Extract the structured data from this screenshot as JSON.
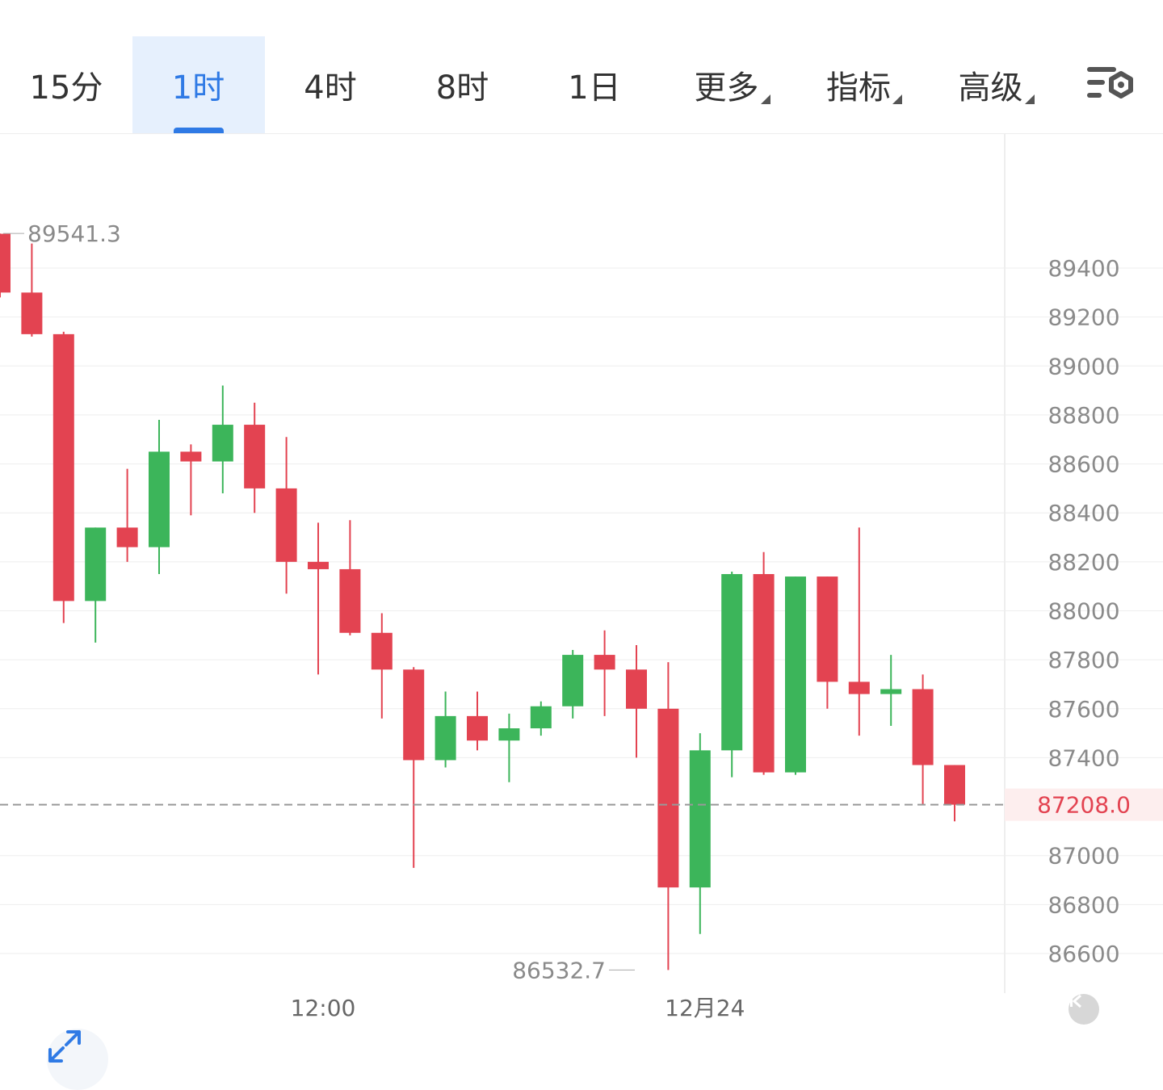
{
  "tabs": [
    {
      "label": "15分",
      "active": false,
      "dropdown": false
    },
    {
      "label": "1时",
      "active": true,
      "dropdown": false
    },
    {
      "label": "4时",
      "active": false,
      "dropdown": false
    },
    {
      "label": "8时",
      "active": false,
      "dropdown": false
    },
    {
      "label": "1日",
      "active": false,
      "dropdown": false
    },
    {
      "label": "更多",
      "active": false,
      "dropdown": true
    },
    {
      "label": "指标",
      "active": false,
      "dropdown": true
    },
    {
      "label": "高级",
      "active": false,
      "dropdown": true
    }
  ],
  "colors": {
    "up": "#3cb55a",
    "down": "#e34351",
    "accent": "#2f7ae5",
    "grid": "#eeeeee",
    "axis_text": "#8a8a8a",
    "price_tag_bg": "#fdeeee"
  },
  "icons": {
    "settings": "chart-settings-icon",
    "expand": "expand-icon",
    "back": "back-to-latest-icon"
  },
  "chart_data": {
    "type": "candlestick",
    "ylim": [
      86400,
      89750
    ],
    "y_ticks": [
      "89400",
      "89200",
      "89000",
      "88800",
      "88600",
      "88400",
      "88200",
      "88000",
      "87800",
      "87600",
      "87400",
      "87000",
      "86800",
      "86600"
    ],
    "y_tick_values": [
      89400,
      89200,
      89000,
      88800,
      88600,
      88400,
      88200,
      88000,
      87800,
      87600,
      87400,
      87000,
      86800,
      86600
    ],
    "x_ticks": [
      {
        "label": "12:00",
        "index": 10
      },
      {
        "label": "12月24",
        "index": 22
      }
    ],
    "current_price": "87208.0",
    "current_price_value": 87208.0,
    "max_label": "89541.3",
    "max_value": 89541.3,
    "max_index": 0,
    "min_label": "86532.7",
    "min_value": 86532.7,
    "min_index": 20,
    "candles": [
      {
        "o": 89540,
        "h": 89541,
        "c": 89300,
        "l": 89280
      },
      {
        "o": 89300,
        "h": 89500,
        "c": 89130,
        "l": 89120
      },
      {
        "o": 89130,
        "h": 89140,
        "c": 88040,
        "l": 87950
      },
      {
        "o": 88040,
        "h": 88340,
        "c": 88340,
        "l": 87870
      },
      {
        "o": 88340,
        "h": 88580,
        "c": 88260,
        "l": 88200
      },
      {
        "o": 88260,
        "h": 88780,
        "c": 88650,
        "l": 88150
      },
      {
        "o": 88650,
        "h": 88680,
        "c": 88610,
        "l": 88390
      },
      {
        "o": 88610,
        "h": 88920,
        "c": 88760,
        "l": 88480
      },
      {
        "o": 88760,
        "h": 88850,
        "c": 88500,
        "l": 88400
      },
      {
        "o": 88500,
        "h": 88710,
        "c": 88200,
        "l": 88070
      },
      {
        "o": 88200,
        "h": 88360,
        "c": 88170,
        "l": 87740
      },
      {
        "o": 88170,
        "h": 88370,
        "c": 87910,
        "l": 87900
      },
      {
        "o": 87910,
        "h": 87990,
        "c": 87760,
        "l": 87560
      },
      {
        "o": 87760,
        "h": 87770,
        "c": 87390,
        "l": 86950
      },
      {
        "o": 87390,
        "h": 87670,
        "c": 87570,
        "l": 87360
      },
      {
        "o": 87570,
        "h": 87670,
        "c": 87470,
        "l": 87430
      },
      {
        "o": 87470,
        "h": 87580,
        "c": 87520,
        "l": 87300
      },
      {
        "o": 87520,
        "h": 87630,
        "c": 87610,
        "l": 87490
      },
      {
        "o": 87610,
        "h": 87840,
        "c": 87820,
        "l": 87560
      },
      {
        "o": 87820,
        "h": 87920,
        "c": 87760,
        "l": 87570
      },
      {
        "o": 87760,
        "h": 87860,
        "c": 87600,
        "l": 87400
      },
      {
        "o": 87600,
        "h": 87790,
        "c": 86870,
        "l": 86532.7
      },
      {
        "o": 86870,
        "h": 87500,
        "c": 87430,
        "l": 86680
      },
      {
        "o": 87430,
        "h": 88160,
        "c": 88150,
        "l": 87320
      },
      {
        "o": 88150,
        "h": 88240,
        "c": 87340,
        "l": 87330
      },
      {
        "o": 87340,
        "h": 88140,
        "c": 88140,
        "l": 87330
      },
      {
        "o": 88140,
        "h": 88000,
        "c": 87710,
        "l": 87600
      },
      {
        "o": 87710,
        "h": 88340,
        "c": 87660,
        "l": 87490
      },
      {
        "o": 87660,
        "h": 87820,
        "c": 87680,
        "l": 87530
      },
      {
        "o": 87680,
        "h": 87740,
        "c": 87370,
        "l": 87210
      },
      {
        "o": 87370,
        "h": 87370,
        "c": 87208,
        "l": 87140
      }
    ]
  }
}
